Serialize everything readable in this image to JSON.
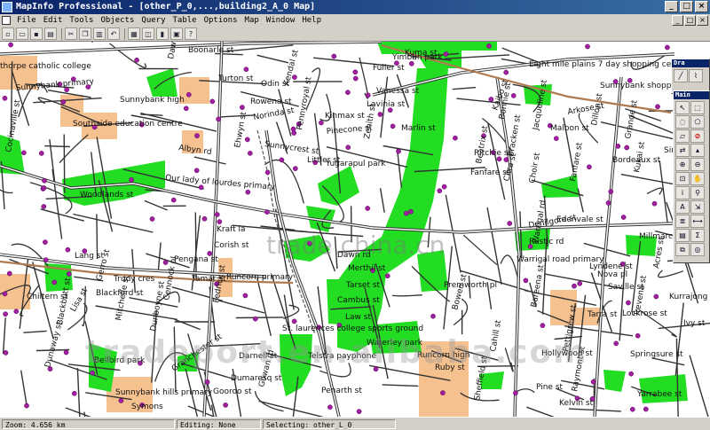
{
  "window": {
    "title": "MapInfo Professional - [other_P_0,...,building2_A_0 Map]",
    "controls": [
      "_",
      "□",
      "×"
    ]
  },
  "menu": {
    "items": [
      "File",
      "Edit",
      "Tools",
      "Objects",
      "Query",
      "Table",
      "Options",
      "Map",
      "Window",
      "Help"
    ],
    "mdi_controls": [
      "_",
      "□",
      "×"
    ]
  },
  "toolbar": {
    "icons": [
      "new-icon",
      "open-icon",
      "save-icon",
      "print-icon",
      "cut-icon",
      "copy-icon",
      "paste-icon",
      "undo-icon",
      "new-browser-icon",
      "new-map-icon",
      "new-graph-icon",
      "new-layout-icon",
      "help-icon"
    ]
  },
  "palettes": {
    "drawing": {
      "title": "Dra"
    },
    "main": {
      "title": "Main"
    }
  },
  "map": {
    "background": "#ffffff",
    "park_color": "#22dd22",
    "school_color": "#f5c18f",
    "poi_color": "#a020a0",
    "road_color": "#333333",
    "rail_color": "#b07a50",
    "labels": [
      "thorpe catholic college",
      "Sunnybank primary",
      "Sunnybank high",
      "Southside education centre",
      "Boonarle st",
      "Dawson rd",
      "Turton st",
      "Odin st",
      "Rowena st",
      "Norinda st",
      "Vanessa st",
      "Lavinia st",
      "Kinmax st",
      "Pinecone st",
      "Sunnycrest st",
      "Littler st",
      "Albyn rd",
      "Our lady of lourdes primary",
      "Yimbun park",
      "Eight mile plains 7 day shopping centre",
      "Sunnybank shopping centre",
      "Arkose st",
      "Malbon st",
      "Bordeaux st",
      "Fanfare st",
      "Yugarapul park",
      "Dawn rd",
      "Warrigal road primary",
      "Rustic rd",
      "Denilgore st",
      "Runcorn primary",
      "Pengana st",
      "Corish st",
      "Kraft la",
      "Fedrick st",
      "Merthil st",
      "Tarset st",
      "Cambus st",
      "Law st",
      "Premworth pl",
      "Gerro st",
      "Lang st",
      "Chiltern st",
      "Cennock pl",
      "Runcorn high",
      "Waterley park",
      "Telstra payphone",
      "St. laurences college sports ground",
      "Bellbird park",
      "Sunnybank hills primary",
      "Darnell st",
      "Dumaresq st",
      "Gooroo st",
      "Symons",
      "Hollywood st",
      "Springsure st",
      "Pine st",
      "Ruby st",
      "Saville st",
      "Nova pl",
      "Bowen st",
      "Gowan rd",
      "Penarth st",
      "Granchester st",
      "Dunboyne st",
      "Rowanbank",
      "Mitchelle st",
      "Blackbutt st",
      "Rowanbank pl",
      "Dunaway st",
      "Trudy cres",
      "Woodlands st",
      "Lisa st",
      "Tamar st",
      "Blackford st",
      "Warrigal rd",
      "Fanfare st",
      "Millmarce st",
      "Cocinaville st",
      "Ehwyn st",
      "Kendal st",
      "Pennyroyal st",
      "Fuller st",
      "Kuma st",
      "Kaibo st",
      "Bracken st",
      "Marlin st",
      "Zenith st",
      "Jacqueline st",
      "Dillon st",
      "Bonnie st",
      "Ritchie st",
      "Beatrix st",
      "Citra st",
      "Choir st",
      "Grande st",
      "Sirocco st",
      "Kukai st",
      "Acres st",
      "Tarra st",
      "Pettigrew st",
      "Trevena st",
      "Bareena st",
      "Ivy st",
      "Yarrabee st",
      "Raymont st",
      "Cahill st",
      "Sheffield st",
      "Kelvin st",
      "Kurrajong st",
      "Jarrah st",
      "Edenvale st",
      "Lyndene st",
      "Lockrose st"
    ]
  },
  "watermarks": {
    "primary": "trade.china.cn",
    "secondary": "tradeport.en.alibaba.com"
  },
  "status": {
    "zoom": "Zoom: 4.656 km",
    "editing": "Editing: None",
    "selecting": "Selecting: other_L_0"
  }
}
